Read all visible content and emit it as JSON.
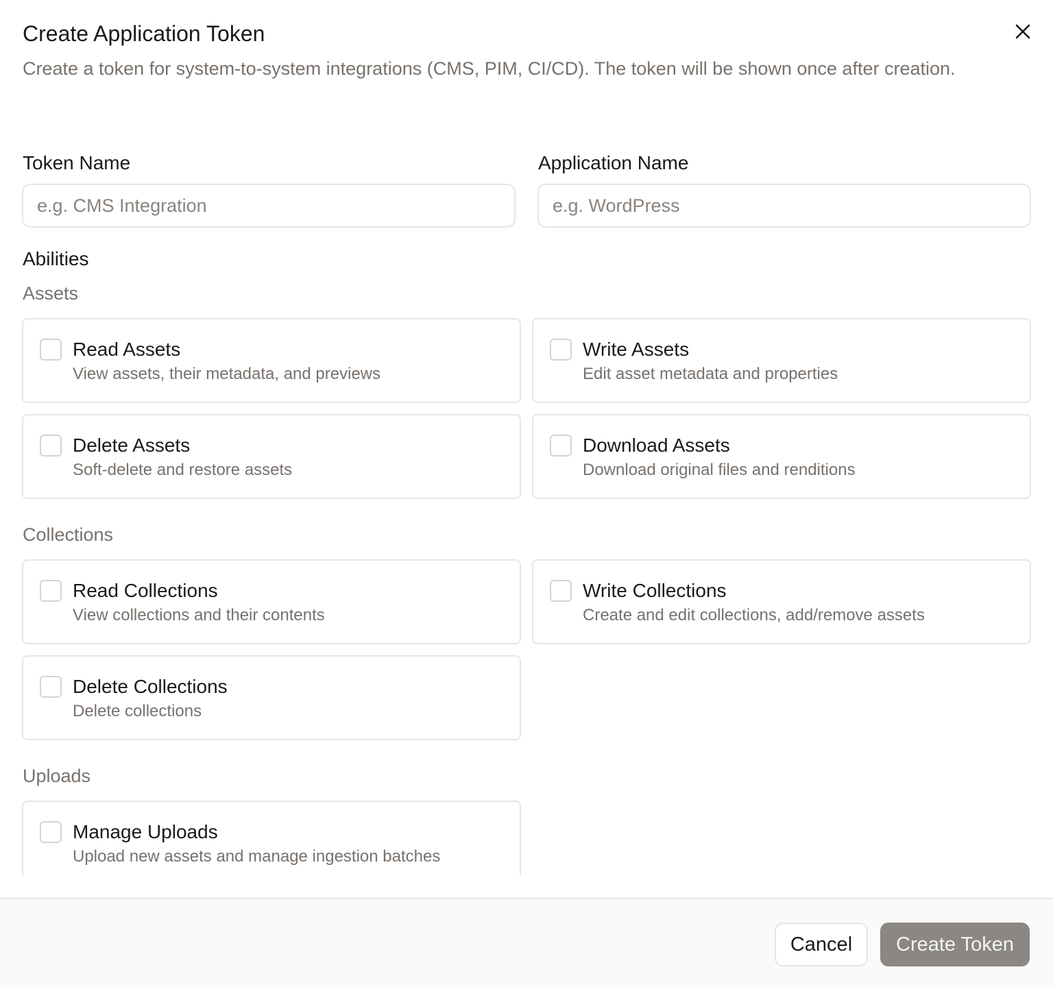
{
  "dialog": {
    "title": "Create Application Token",
    "description": "Create a token for system-to-system integrations (CMS, PIM, CI/CD). The token will be shown once after creation."
  },
  "fields": {
    "token_name": {
      "label": "Token Name",
      "placeholder": "e.g. CMS Integration",
      "value": ""
    },
    "application_name": {
      "label": "Application Name",
      "placeholder": "e.g. WordPress",
      "value": ""
    }
  },
  "abilities": {
    "heading": "Abilities",
    "groups": [
      {
        "name": "Assets",
        "items": [
          {
            "title": "Read Assets",
            "description": "View assets, their metadata, and previews",
            "checked": false
          },
          {
            "title": "Write Assets",
            "description": "Edit asset metadata and properties",
            "checked": false
          },
          {
            "title": "Delete Assets",
            "description": "Soft-delete and restore assets",
            "checked": false
          },
          {
            "title": "Download Assets",
            "description": "Download original files and renditions",
            "checked": false
          }
        ]
      },
      {
        "name": "Collections",
        "items": [
          {
            "title": "Read Collections",
            "description": "View collections and their contents",
            "checked": false
          },
          {
            "title": "Write Collections",
            "description": "Create and edit collections, add/remove assets",
            "checked": false
          },
          {
            "title": "Delete Collections",
            "description": "Delete collections",
            "checked": false
          }
        ]
      },
      {
        "name": "Uploads",
        "items": [
          {
            "title": "Manage Uploads",
            "description": "Upload new assets and manage ingestion batches",
            "checked": false
          }
        ]
      }
    ]
  },
  "footer": {
    "cancel_label": "Cancel",
    "create_label": "Create Token"
  },
  "icons": {
    "close": "close-icon"
  },
  "colors": {
    "text": "#1c1917",
    "muted": "#78716c",
    "border": "#e7e5e4",
    "primary_disabled": "#8a8784",
    "footer_bg": "#fafaf9"
  }
}
